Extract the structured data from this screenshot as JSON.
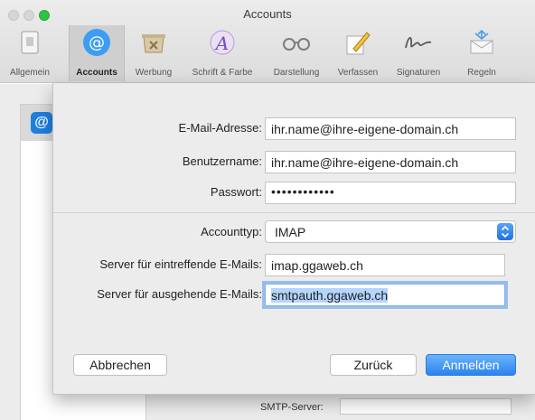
{
  "window": {
    "title": "Accounts"
  },
  "toolbar": {
    "items": [
      {
        "label": "Allgemein",
        "icon": "switch-icon"
      },
      {
        "label": "Accounts",
        "icon": "at-sign-icon"
      },
      {
        "label": "Werbung",
        "icon": "junk-mail-icon"
      },
      {
        "label": "Schrift & Farbe",
        "icon": "font-color-icon"
      },
      {
        "label": "Darstellung",
        "icon": "glasses-icon"
      },
      {
        "label": "Verfassen",
        "icon": "pencil-icon"
      },
      {
        "label": "Signaturen",
        "icon": "signature-icon"
      },
      {
        "label": "Regeln",
        "icon": "rules-icon"
      }
    ]
  },
  "background": {
    "smtp_label": "SMTP-Server:"
  },
  "form": {
    "email_label": "E-Mail-Adresse:",
    "email_value": "ihr.name@ihre-eigene-domain.ch",
    "username_label": "Benutzername:",
    "username_value": "ihr.name@ihre-eigene-domain.ch",
    "password_label": "Passwort:",
    "password_value": "••••••••••••",
    "account_type_label": "Accounttyp:",
    "account_type_value": "IMAP",
    "incoming_label": "Server für eintreffende E-Mails:",
    "incoming_value": "imap.ggaweb.ch",
    "outgoing_label": "Server für ausgehende E-Mails:",
    "outgoing_value": "smtpauth.ggaweb.ch"
  },
  "buttons": {
    "cancel": "Abbrechen",
    "back": "Zurück",
    "signin": "Anmelden"
  },
  "colors": {
    "accent": "#2a83f0",
    "focus_ring": "#5896ec"
  }
}
